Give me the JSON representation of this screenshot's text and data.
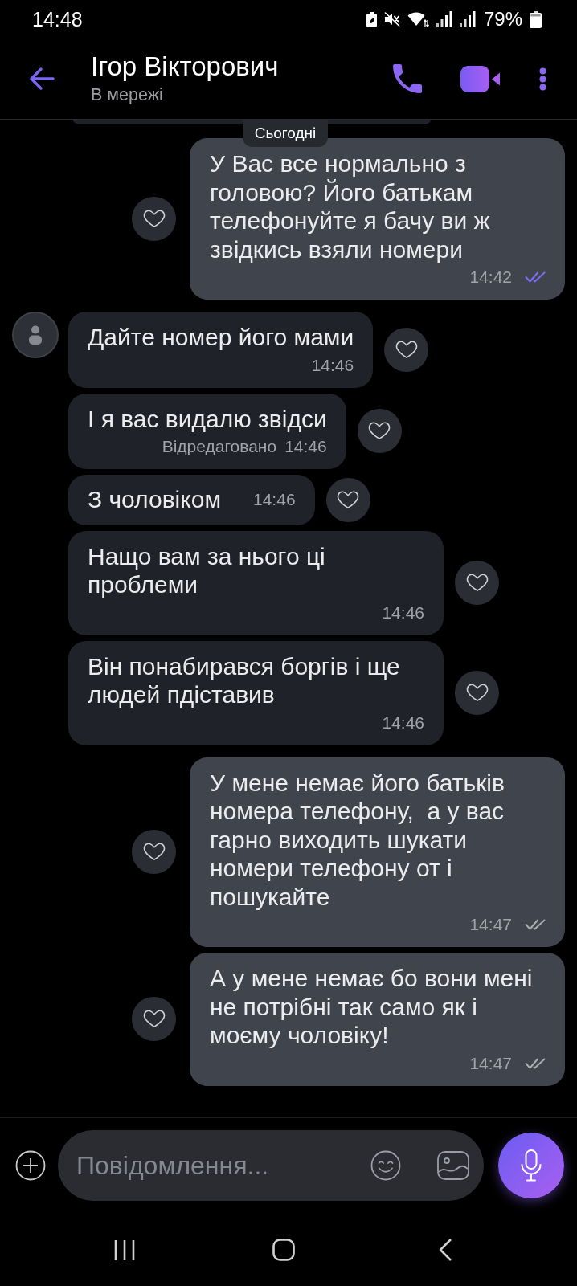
{
  "status_bar": {
    "time": "14:48",
    "battery": "79%"
  },
  "header": {
    "title": "Ігор Вікторович",
    "status": "В мережі"
  },
  "date_separator": {
    "label": "Сьогодні"
  },
  "messages": [
    {
      "kind": "outgoing",
      "text": "У Вас все нормально з головою? Його батькам телефонуйте я бачу ви ж звідкись взяли номери",
      "time": "14:42",
      "read": true
    },
    {
      "kind": "incoming",
      "avatar": true,
      "text": "Дайте номер його мами",
      "time": "14:46"
    },
    {
      "kind": "incoming",
      "avatar": false,
      "text": "І я вас видалю звідси",
      "edited": "Відредаговано",
      "time": "14:46"
    },
    {
      "kind": "incoming",
      "avatar": false,
      "text": "З чоловіком",
      "time": "14:46"
    },
    {
      "kind": "incoming",
      "avatar": false,
      "text": "Нащо вам за нього ці проблеми",
      "time": "14:46"
    },
    {
      "kind": "incoming",
      "avatar": false,
      "text": "Він понабирався боргів і ще людей пдіставив",
      "time": "14:46"
    },
    {
      "kind": "outgoing",
      "text": "У мене немає його батьків номера телефону,  а у вас гарно виходить шукати номери телефону от і пошукайте",
      "time": "14:47",
      "read": false
    },
    {
      "kind": "outgoing",
      "text": "А у мене немає бо вони мені не потрібні так само як і моєму чоловіку!",
      "time": "14:47",
      "read": false
    }
  ],
  "composer": {
    "placeholder": "Повідомлення..."
  }
}
